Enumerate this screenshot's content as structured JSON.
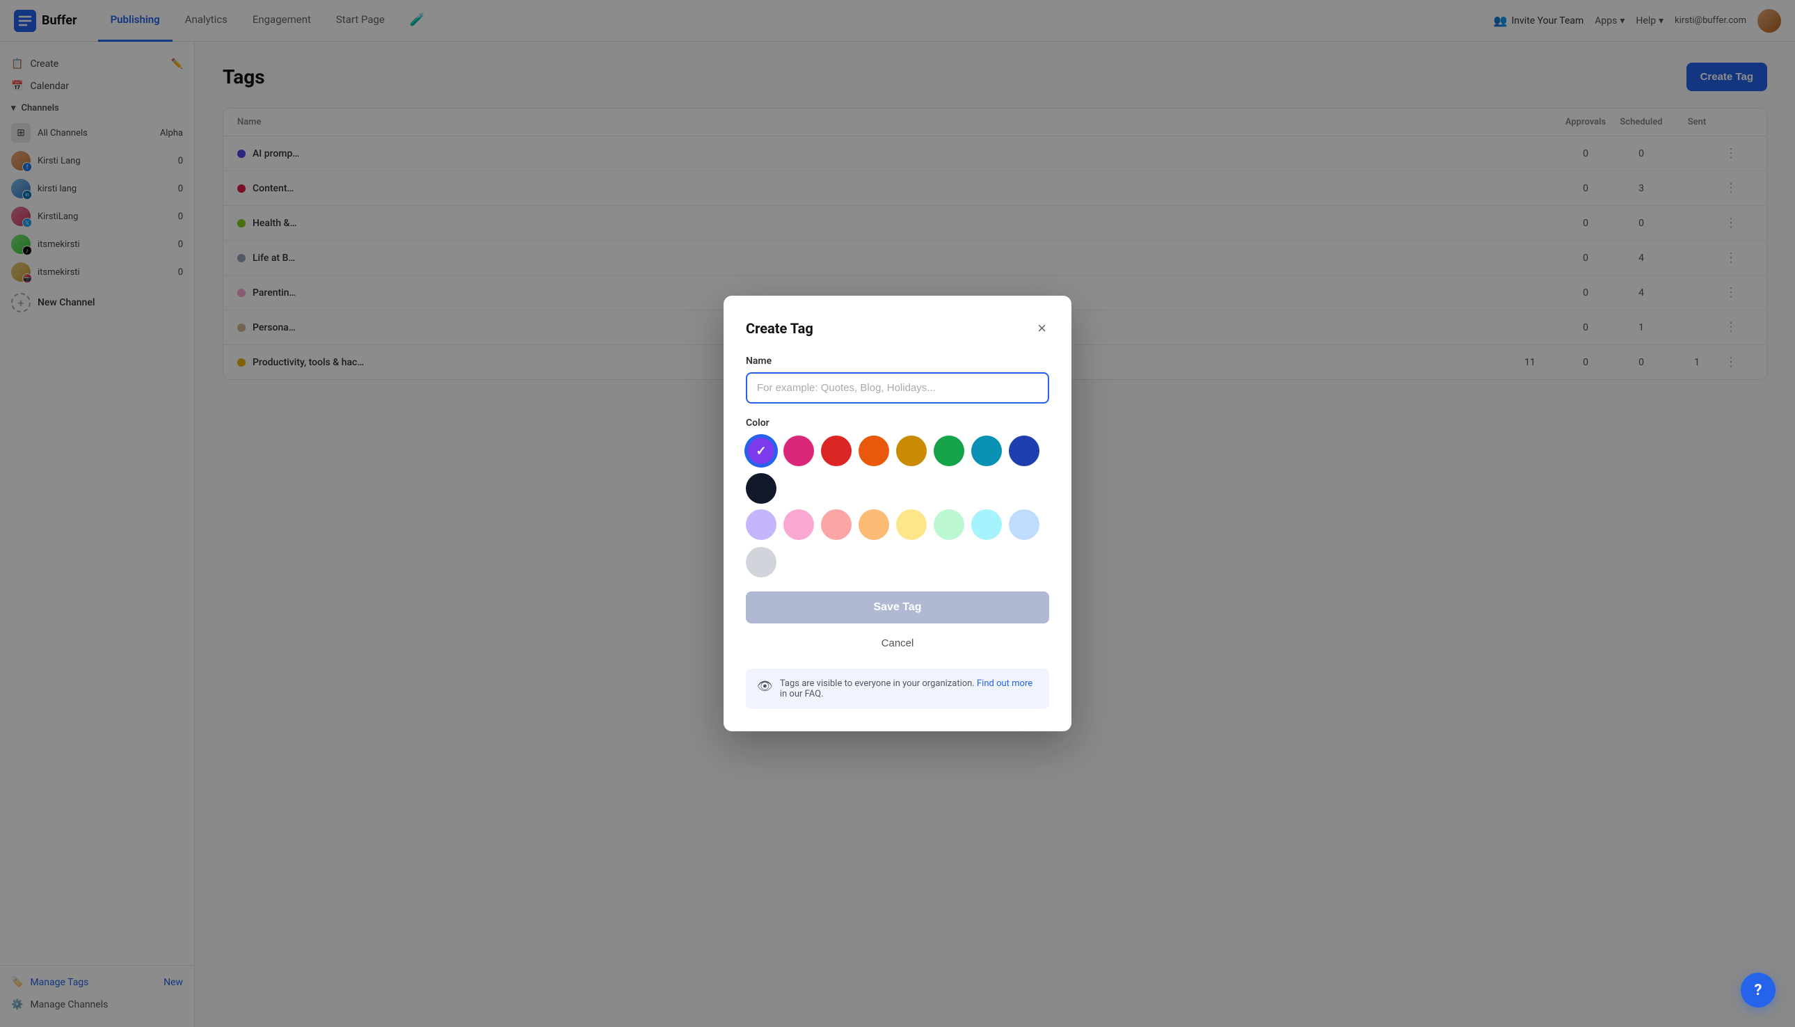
{
  "app": {
    "name": "Buffer"
  },
  "topnav": {
    "links": [
      {
        "id": "publishing",
        "label": "Publishing",
        "active": true
      },
      {
        "id": "analytics",
        "label": "Analytics",
        "active": false
      },
      {
        "id": "engagement",
        "label": "Engagement",
        "active": false
      },
      {
        "id": "start-page",
        "label": "Start Page",
        "active": false
      }
    ],
    "invite_label": "Invite Your Team",
    "apps_label": "Apps",
    "help_label": "Help",
    "user_email": "kirsti@buffer.com"
  },
  "sidebar": {
    "create_label": "Create",
    "calendar_label": "Calendar",
    "channels_label": "Channels",
    "all_channels_label": "All Channels",
    "all_channels_badge": "Alpha",
    "channels": [
      {
        "name": "Kirsti Lang",
        "count": 0,
        "avatar_class": "ch-av-1",
        "platform": "fb",
        "platform_class": "platform-fb"
      },
      {
        "name": "kirsti lang",
        "count": 0,
        "avatar_class": "ch-av-2",
        "platform": "li",
        "platform_class": "platform-li"
      },
      {
        "name": "KirstiLang",
        "count": 0,
        "avatar_class": "ch-av-3",
        "platform": "tw",
        "platform_class": "platform-tw"
      },
      {
        "name": "itsmekirsti",
        "count": 0,
        "avatar_class": "ch-av-4",
        "platform": "tk",
        "platform_class": "platform-tk"
      },
      {
        "name": "itsmekirsti",
        "count": 0,
        "avatar_class": "ch-av-5",
        "platform": "ig",
        "platform_class": "platform-ig"
      }
    ],
    "new_channel_label": "New Channel",
    "manage_tags_label": "Manage Tags",
    "manage_tags_badge": "New",
    "manage_channels_label": "Manage Channels"
  },
  "page": {
    "title": "Tags",
    "create_tag_btn": "Create Tag"
  },
  "table": {
    "headers": [
      "Name",
      "",
      "Approvals",
      "Scheduled",
      "Sent",
      ""
    ],
    "rows": [
      {
        "name": "AI promp...",
        "dot_color": "#4f46e5",
        "col1": "",
        "approvals": "0",
        "scheduled": "0",
        "sent": ""
      },
      {
        "name": "Content...",
        "dot_color": "#e11d48",
        "col1": "",
        "approvals": "0",
        "scheduled": "3",
        "sent": ""
      },
      {
        "name": "Health &...",
        "dot_color": "#84cc16",
        "col1": "",
        "approvals": "0",
        "scheduled": "0",
        "sent": ""
      },
      {
        "name": "Life at B...",
        "dot_color": "#94a3b8",
        "col1": "",
        "approvals": "0",
        "scheduled": "4",
        "sent": ""
      },
      {
        "name": "Parentin...",
        "dot_color": "#f9a8d4",
        "col1": "",
        "approvals": "0",
        "scheduled": "4",
        "sent": ""
      },
      {
        "name": "Persona...",
        "dot_color": "#d4b896",
        "col1": "",
        "approvals": "0",
        "scheduled": "1",
        "sent": ""
      },
      {
        "name": "Productivity, tools & hac...",
        "col1": "11",
        "dot_color": "#eab308",
        "approvals": "0",
        "scheduled": "0",
        "sent": "1"
      }
    ]
  },
  "modal": {
    "title": "Create Tag",
    "close_label": "×",
    "name_label": "Name",
    "name_placeholder": "For example: Quotes, Blog, Holidays...",
    "color_label": "Color",
    "colors_row1": [
      {
        "id": "purple",
        "hex": "#7c3aed",
        "selected": true
      },
      {
        "id": "pink-hot",
        "hex": "#db2777"
      },
      {
        "id": "red",
        "hex": "#dc2626"
      },
      {
        "id": "orange",
        "hex": "#ea580c"
      },
      {
        "id": "yellow",
        "hex": "#ca8a04"
      },
      {
        "id": "green",
        "hex": "#16a34a"
      },
      {
        "id": "teal",
        "hex": "#0891b2"
      },
      {
        "id": "navy",
        "hex": "#1e40af"
      },
      {
        "id": "black",
        "hex": "#111827"
      }
    ],
    "colors_row2": [
      {
        "id": "light-purple",
        "hex": "#c4b5fd"
      },
      {
        "id": "light-pink",
        "hex": "#f9a8d4"
      },
      {
        "id": "light-red",
        "hex": "#fca5a5"
      },
      {
        "id": "light-orange",
        "hex": "#fdba74"
      },
      {
        "id": "light-yellow",
        "hex": "#fde68a"
      },
      {
        "id": "light-green",
        "hex": "#bbf7d0"
      },
      {
        "id": "light-teal",
        "hex": "#a5f3fc"
      },
      {
        "id": "light-blue",
        "hex": "#bfdbfe"
      },
      {
        "id": "light-gray",
        "hex": "#d1d5db"
      }
    ],
    "save_btn": "Save Tag",
    "cancel_btn": "Cancel",
    "info_text": "Tags are visible to everyone in your organization.",
    "info_link": "Find out more",
    "info_suffix": " in our FAQ."
  },
  "help": {
    "label": "?"
  }
}
